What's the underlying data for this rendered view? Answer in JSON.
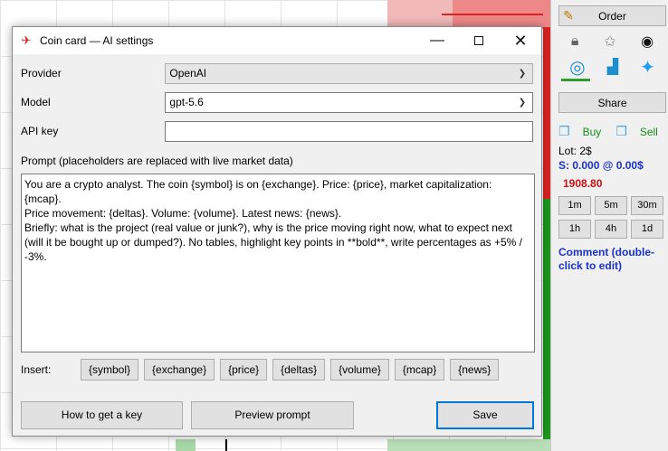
{
  "side_panel": {
    "order_label": "Order",
    "share_label": "Share",
    "buy_label": "Buy",
    "sell_label": "Sell",
    "lot": "Lot: 2$",
    "position": "S: 0.000 @ 0.00$",
    "price": "1908.80",
    "timeframes": [
      "1m",
      "5m",
      "30m",
      "1h",
      "4h",
      "1d"
    ],
    "comment": "Comment (double-click to edit)",
    "icons": [
      "pencil-icon",
      "lock-icon",
      "star-icon",
      "eye-icon",
      "watch-eye-icon",
      "chart-icon",
      "twitter-icon",
      "cube-icon"
    ]
  },
  "dialog": {
    "title": "Coin card — AI settings",
    "provider": {
      "label": "Provider",
      "value": "OpenAI"
    },
    "model": {
      "label": "Model",
      "value": "gpt-5.6"
    },
    "api_key": {
      "label": "API key",
      "value": ""
    },
    "prompt_label": "Prompt (placeholders are replaced with live market data)",
    "prompt_lines": [
      "You are a crypto analyst. The coin {symbol} is on {exchange}. Price: {price}, market capitalization: {mcap}.",
      "Price movement: {deltas}. Volume: {volume}. Latest news: {news}.",
      "Briefly: what is the project (real value or junk?), why is the price moving right now, what to expect next (will it be bought up or dumped?). No tables, highlight key points in **bold**, write percentages as +5% / -3%."
    ],
    "insert_label": "Insert:",
    "placeholders": [
      "{symbol}",
      "{exchange}",
      "{price}",
      "{deltas}",
      "{volume}",
      "{mcap}",
      "{news}"
    ],
    "how_to_label": "How to get a key",
    "preview_label": "Preview prompt",
    "save_label": "Save"
  }
}
